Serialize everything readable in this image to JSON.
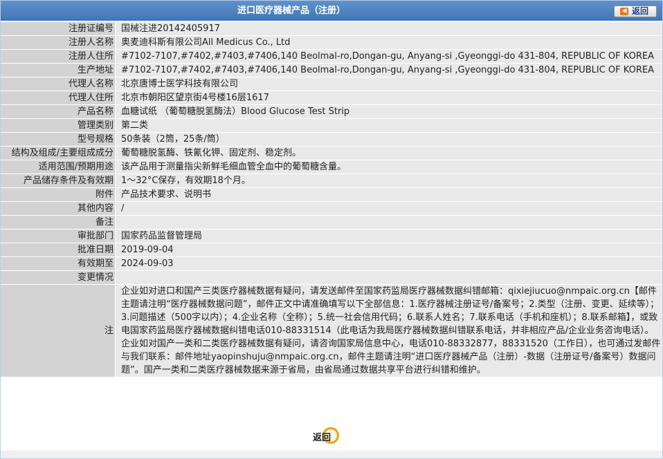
{
  "page": {
    "title": "进口医疗器械产品（注册）",
    "back_label": "返回",
    "back_bottom_label": "返回"
  },
  "fields": [
    {
      "label": "注册证编号",
      "value": "国械注进20142405917"
    },
    {
      "label": "注册人名称",
      "value": "奥麦迪科斯有限公司All Medicus Co., Ltd"
    },
    {
      "label": "注册人住所",
      "value": "#7102-7107,#7402,#7403,#7406,140 Beolmal-ro,Dongan-gu, Anyang-si ,Gyeonggi-do 431-804, REPUBLIC OF KOREA"
    },
    {
      "label": "生产地址",
      "value": "#7102-7107,#7402,#7403,#7406,140 Beolmal-ro,Dongan-gu, Anyang-si ,Gyeonggi-do 431-804, REPUBLIC OF KOREA"
    },
    {
      "label": "代理人名称",
      "value": "北京唐博士医学科技有限公司"
    },
    {
      "label": "代理人住所",
      "value": "北京市朝阳区望京街4号楼16层1617"
    },
    {
      "label": "产品名称",
      "value": "血糖试纸 （葡萄糖脱氢酶法）Blood Glucose Test Strip"
    },
    {
      "label": "管理类别",
      "value": "第二类"
    },
    {
      "label": "型号规格",
      "value": "50条装（2筒，25条/筒）"
    },
    {
      "label": "结构及组成/主要组成成分",
      "value": "葡萄糖脱氢酶、铁氰化钾、固定剂、稳定剂。"
    },
    {
      "label": "适用范围/预期用途",
      "value": "该产品用于测量指尖新鲜毛细血管全血中的葡萄糖含量。"
    },
    {
      "label": "产品储存条件及有效期",
      "value": "1～32°C保存，有效期18个月。"
    },
    {
      "label": "附件",
      "value": "产品技术要求、说明书"
    },
    {
      "label": "其他内容",
      "value": "/"
    },
    {
      "label": "备注",
      "value": ""
    },
    {
      "label": "审批部门",
      "value": "国家药品监督管理局"
    },
    {
      "label": "批准日期",
      "value": "2019-09-04"
    },
    {
      "label": "有效期至",
      "value": "2024-09-03"
    },
    {
      "label": "变更情况",
      "value": ""
    }
  ],
  "notice": {
    "label": "注",
    "text": "企业如对进口和国产三类医疗器械数据有疑问，请发送邮件至国家药监局医疗器械数据纠错邮箱：qixiejiucuo@nmpaic.org.cn【邮件主题请注明“医疗器械数据问题”，邮件正文中请准确填写以下全部信息：1.医疗器械注册证号/备案号；2.类型（注册、变更、延续等）；3.问题描述（500字以内）；4.企业名称（全称）；5.统一社会信用代码；6.联系人姓名；7.联系电话（手机和座机）；8.联系邮箱】，或致电国家药监局医疗器械数据纠错电话010-88331514（此电话为我局医疗器械数据纠错联系电话，并非相应产品/企业业务咨询电话）。企业如对国产一类和二类医疗器械数据有疑问，请咨询国家局信息中心，电话010-88332877，88331520（工作日），也可通过发邮件与我们联系：邮件地址yaopinshuju@nmpaic.org.cn，邮件主题请注明“进口医疗器械产品（注册）-数据（注册证号/备案号）数据问题”。国产一类和二类医疗器械数据来源于省局，由省局通过数据共享平台进行纠错和维护。"
  },
  "colors": {
    "title_bar": "#4a80be",
    "label_bg": "#d3d3d3",
    "value_bg": "#e9e9e9",
    "back_arrow": "#e8761b",
    "back_ring": "#f1a10d"
  },
  "icons": {
    "back_top": "back-arrow-icon",
    "back_bottom": "back-circle-icon"
  }
}
